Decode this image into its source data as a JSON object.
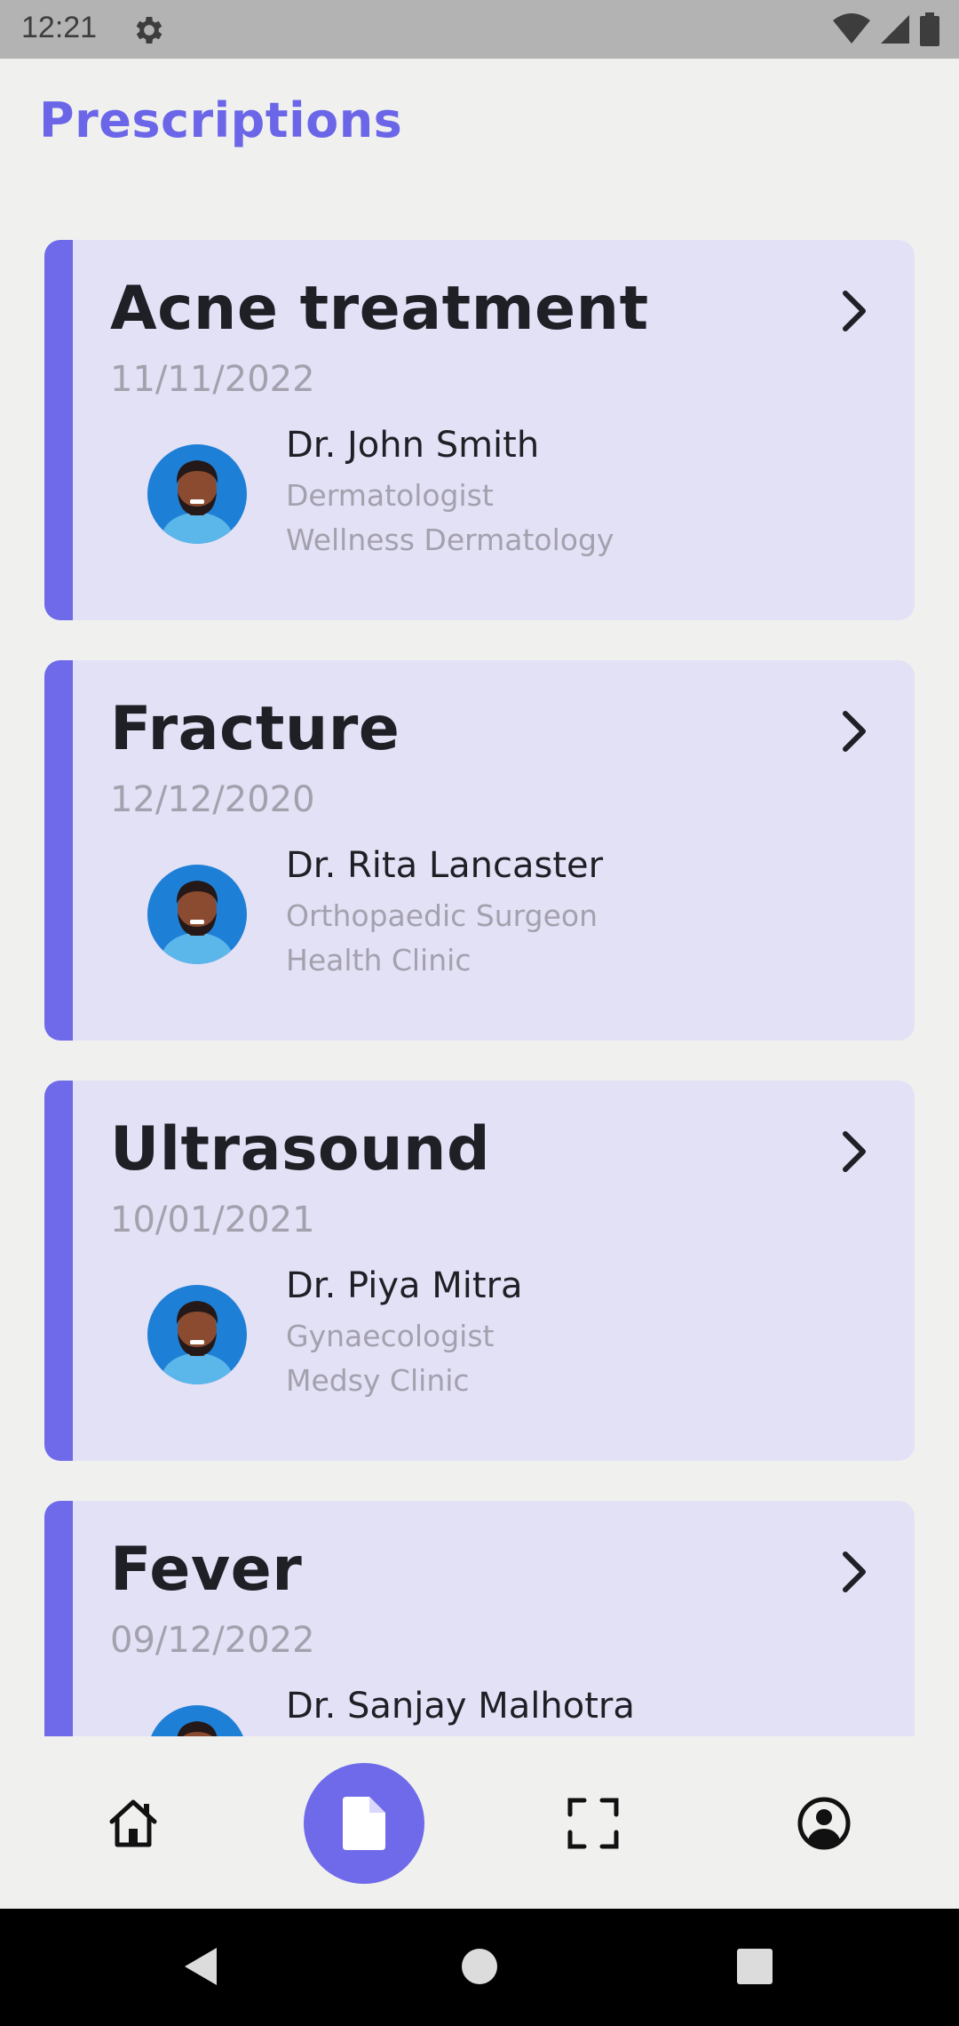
{
  "status": {
    "time": "12:21"
  },
  "page": {
    "title": "Prescriptions"
  },
  "prescriptions": [
    {
      "title": "Acne treatment",
      "date": "11/11/2022",
      "doctor": "Dr. John Smith",
      "specialty": "Dermatologist",
      "clinic": "Wellness Dermatology"
    },
    {
      "title": "Fracture",
      "date": "12/12/2020",
      "doctor": "Dr. Rita Lancaster",
      "specialty": "Orthopaedic Surgeon",
      "clinic": "Health Clinic"
    },
    {
      "title": "Ultrasound",
      "date": "10/01/2021",
      "doctor": "Dr. Piya Mitra",
      "specialty": "Gynaecologist",
      "clinic": "Medsy Clinic"
    },
    {
      "title": "Fever",
      "date": "09/12/2022",
      "doctor": "Dr. Sanjay Malhotra",
      "specialty": "",
      "clinic": ""
    }
  ],
  "nav": {
    "items": [
      {
        "icon": "home-icon",
        "active": false
      },
      {
        "icon": "document-icon",
        "active": true
      },
      {
        "icon": "scan-icon",
        "active": false
      },
      {
        "icon": "account-icon",
        "active": false
      }
    ],
    "accent_color": "#6f6ae9"
  },
  "colors": {
    "title": "#6b66e8",
    "card_bg": "#e3e1f6",
    "accent": "#6f6ae9",
    "avatar_bg": "#1e7fd6"
  }
}
